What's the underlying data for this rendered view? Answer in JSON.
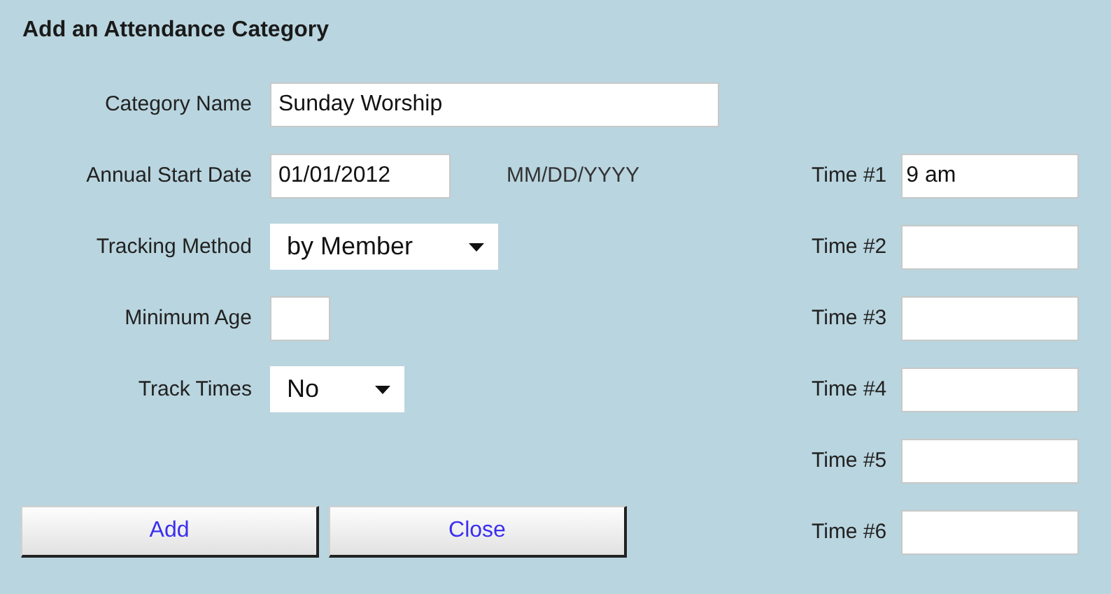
{
  "title": "Add an Attendance Category",
  "fields": [
    {
      "kind": "text",
      "label": "Category Name",
      "value": "Sunday Worship"
    },
    {
      "kind": "date",
      "label": "Annual Start Date",
      "value": "01/01/2012",
      "hint": "MM/DD/YYYY"
    },
    {
      "kind": "select",
      "label": "Tracking Method",
      "value": "by Member"
    },
    {
      "kind": "number",
      "label": "Minimum Age"
    },
    {
      "kind": "select",
      "label": "Track Times",
      "value": "No"
    }
  ],
  "times": [
    {
      "label": "Time #1",
      "value": "9 am"
    },
    {
      "label": "Time #2"
    },
    {
      "label": "Time #3"
    },
    {
      "label": "Time #4"
    },
    {
      "label": "Time #5"
    },
    {
      "label": "Time #6"
    }
  ],
  "buttons": [
    "Add",
    "Close"
  ]
}
